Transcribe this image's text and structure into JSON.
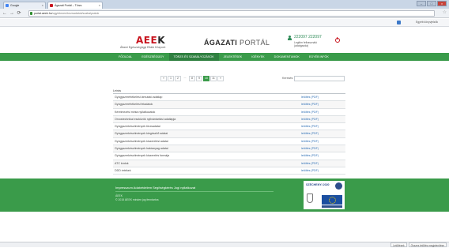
{
  "browser": {
    "tabs": [
      {
        "label": "Google",
        "active": false,
        "color": "#4285f4"
      },
      {
        "label": "Ágazati Portál – Törzs",
        "active": true,
        "color": "#c8141e"
      }
    ],
    "window_buttons": [
      "–",
      "□",
      "×"
    ],
    "url_host": "portal.aeek.hu",
    "url_path": "/ugyintezes/torzsadatok/szabalyzatok",
    "bookmarks_other": "Egyéb könyvjelzők"
  },
  "site": {
    "logo": {
      "text_a": "AEE",
      "text_b": "K"
    },
    "logo_subtitle": "Állami Egészségügyi Ellátó Központ",
    "portal_title": {
      "bold": "ÁGAZATI",
      "light": "PORTÁL"
    },
    "user": {
      "id": "222097 222097",
      "line1": "Legitim felhasználó",
      "line2": "(adatgazda)"
    },
    "nav": [
      {
        "label": "Főoldal",
        "active": false
      },
      {
        "label": "Egészségügy",
        "active": false
      },
      {
        "label": "Törzs és szabályozások",
        "active": true
      },
      {
        "label": "Jelentések",
        "active": false
      },
      {
        "label": "Igények",
        "active": false
      },
      {
        "label": "Dokumentumok",
        "active": false
      },
      {
        "label": "Egyéb infók",
        "active": false
      }
    ]
  },
  "pager": {
    "items": [
      "«",
      "1",
      "2",
      "...",
      "8",
      "9",
      "10",
      "11",
      "»"
    ],
    "active": "10"
  },
  "search": {
    "label": "Keresés:",
    "placeholder": ""
  },
  "table": {
    "header": "Leírás",
    "rows": [
      {
        "name": "Gyógyszerértékelési útmutató adatlap",
        "link": "letöltés (PDF)"
      },
      {
        "name": "Gyógyszerértékelési feladatok",
        "link": "letöltés (PDF)"
      },
      {
        "name": "Kérelmezési minta nyilatkozatok",
        "link": "letöltés (PDF)"
      },
      {
        "name": "Orvostechnikai eszközök nyilvántartási adatlapja",
        "link": "letöltés (PDF)"
      },
      {
        "name": "Gyógyszerkészítmények törzsadatai",
        "link": "letöltés (PDF)"
      },
      {
        "name": "Gyógyszerkészítmények kiegészítő adatai",
        "link": "letöltés (PDF)"
      },
      {
        "name": "Gyógyszerkészítmények kiszerelési adatai",
        "link": "letöltés (PDF)"
      },
      {
        "name": "Gyógyszerkészítmények hatóanyag adatai",
        "link": "letöltés (PDF)"
      },
      {
        "name": "Gyógyszerkészítmények kiszerelés formája",
        "link": "letöltés (PDF)"
      },
      {
        "name": "ATC kódok",
        "link": "letöltés (PDF)"
      },
      {
        "name": "DDD értékek",
        "link": "letöltés (PDF)"
      }
    ]
  },
  "footer": {
    "links": "Impresszum  Adatvédelem  Segítségkérés  Jogi nyilatkozat",
    "line1": "ÁEEK",
    "line2": "© 2015 ÁEEK minden jog fenntartva",
    "badge": "SZÉCHENYI 2020"
  },
  "status": {
    "left": "Letöltések",
    "right": "Összes letöltés megjelenítése"
  }
}
